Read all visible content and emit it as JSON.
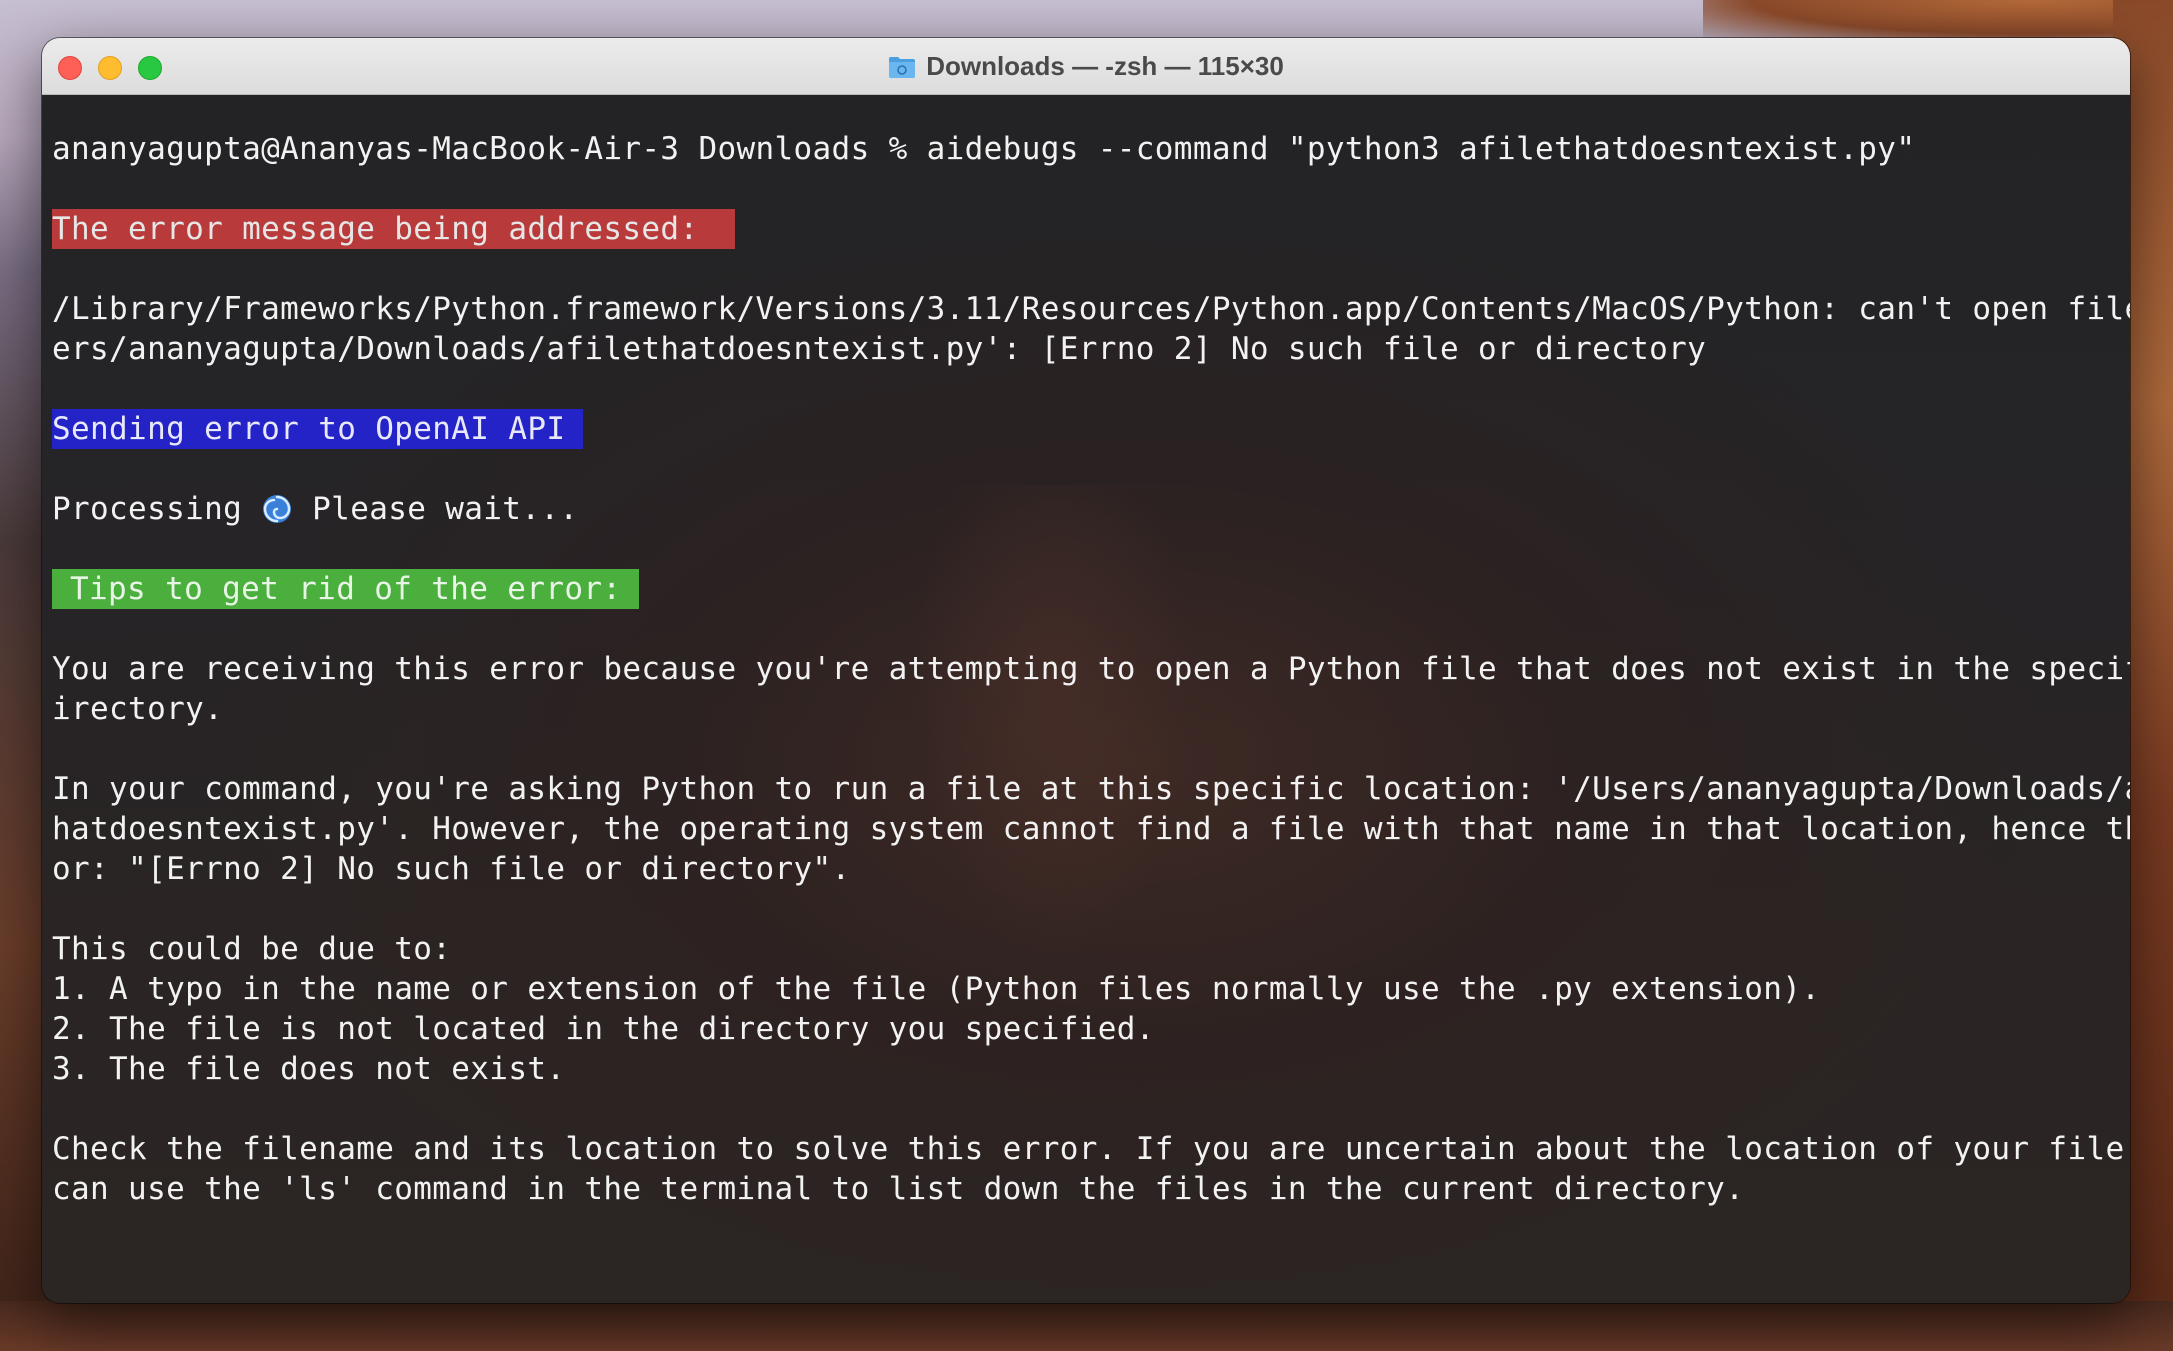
{
  "window": {
    "title": "Downloads — -zsh — 115×30"
  },
  "terminal": {
    "prompt": "ananyagupta@Ananyas-MacBook-Air-3 Downloads % aidebugs --command \"python3 afilethatdoesntexist.py\"",
    "error_badge": "The error message being addressed: ",
    "error_line_1": "/Library/Frameworks/Python.framework/Versions/3.11/Resources/Python.app/Contents/MacOS/Python: can't open file '/Us",
    "error_line_2": "ers/ananyagupta/Downloads/afilethatdoesntexist.py': [Errno 2] No such file or directory",
    "sending_badge": "Sending error to OpenAI API",
    "processing_before": "Processing ",
    "processing_after": " Please wait...",
    "tips_badge": "Tips to get rid of the error:",
    "para1_line1": "You are receiving this error because you're attempting to open a Python file that does not exist in the specified d",
    "para1_line2": "irectory.",
    "para2_line1": "In your command, you're asking Python to run a file at this specific location: '/Users/ananyagupta/Downloads/afilet",
    "para2_line2": "hatdoesntexist.py'. However, the operating system cannot find a file with that name in that location, hence the err",
    "para2_line3": "or: \"[Errno 2] No such file or directory\".",
    "list_intro": "This could be due to:",
    "list_1": "1. A typo in the name or extension of the file (Python files normally use the .py extension).",
    "list_2": "2. The file is not located in the directory you specified.",
    "list_3": "3. The file does not exist.",
    "para3_line1": "Check the filename and its location to solve this error. If you are uncertain about the location of your file, you",
    "para3_line2": "can use the 'ls' command in the terminal to list down the files in the current directory."
  },
  "colors": {
    "error_badge_bg": "#b83a3a",
    "sending_badge_bg": "#2323c8",
    "tips_badge_bg": "#4aaf3c"
  },
  "icons": {
    "title": "folder-icon",
    "processing": "cyclone-icon"
  }
}
